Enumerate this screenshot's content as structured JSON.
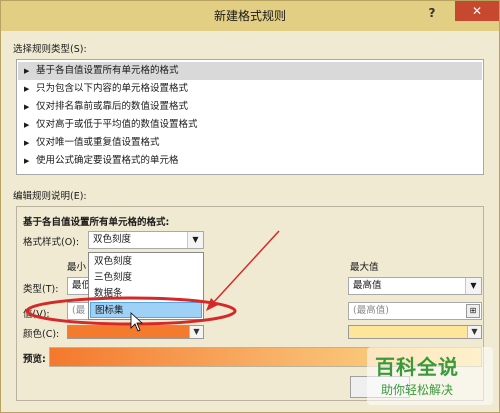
{
  "window": {
    "title": "新建格式规则",
    "help_glyph": "?",
    "close_glyph": "✕"
  },
  "rule_type": {
    "label": "选择规则类型(S):",
    "arrow": "▶",
    "items": [
      "基于各自值设置所有单元格的格式",
      "只为包含以下内容的单元格设置格式",
      "仅对排名靠前或靠后的数值设置格式",
      "仅对高于或低于平均值的数值设置格式",
      "仅对唯一值或重复值设置格式",
      "使用公式确定要设置格式的单元格"
    ]
  },
  "edit": {
    "label": "编辑规则说明(E):",
    "heading": "基于各自值设置所有单元格的格式:",
    "format_style_label": "格式样式(O):",
    "format_style_value": "双色刻度",
    "min_header": "最小",
    "max_header": "最大值",
    "type_label": "类型(T):",
    "min_type": "最低",
    "max_type": "最高值",
    "value_label": "值(V):",
    "min_value_placeholder": "(最",
    "max_value_placeholder": "(最高值)",
    "color_label": "颜色(C):",
    "preview_label": "预览:",
    "min_color": "#f47a2e",
    "max_color": "#fde59a"
  },
  "dropdown": {
    "options": [
      "双色刻度",
      "三色刻度",
      "数据条",
      "图标集"
    ],
    "highlighted_index": 3
  },
  "glyphs": {
    "dropdown_arrow": "▼",
    "ref_button": "⊞"
  },
  "watermark": {
    "main": "百科全说",
    "sub": "助你轻松解决"
  },
  "colors": {
    "titlebar": "#e2cf84",
    "dialog_bg": "#f0ead2",
    "annotation_red": "#d62828"
  }
}
